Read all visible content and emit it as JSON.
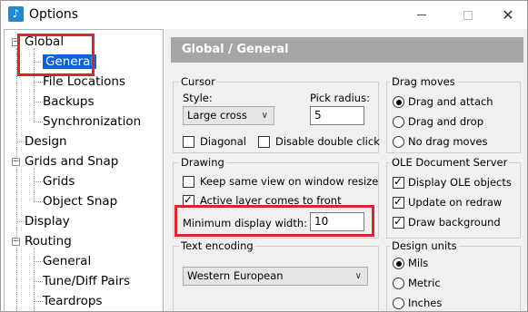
{
  "window": {
    "title": "Options",
    "app_icon": "music-note-icon"
  },
  "tree": {
    "items": [
      {
        "label": "Global",
        "level": 0,
        "expander": "−"
      },
      {
        "label": "General",
        "level": 1,
        "selected": true
      },
      {
        "label": "File Locations",
        "level": 1
      },
      {
        "label": "Backups",
        "level": 1
      },
      {
        "label": "Synchronization",
        "level": 1
      },
      {
        "label": "Design",
        "level": 0
      },
      {
        "label": "Grids and Snap",
        "level": 0,
        "expander": "−"
      },
      {
        "label": "Grids",
        "level": 1
      },
      {
        "label": "Object Snap",
        "level": 1
      },
      {
        "label": "Display",
        "level": 0
      },
      {
        "label": "Routing",
        "level": 0,
        "expander": "−"
      },
      {
        "label": "General",
        "level": 1
      },
      {
        "label": "Tune/Diff Pairs",
        "level": 1
      },
      {
        "label": "Teardrops",
        "level": 1
      }
    ]
  },
  "header": {
    "title": "Global / General"
  },
  "cursor": {
    "group_label": "Cursor",
    "style_label": "Style:",
    "style_value": "Large cross",
    "pick_radius_label": "Pick radius:",
    "pick_radius_value": "5",
    "diagonal_label": "Diagonal",
    "diagonal_checked": false,
    "disable_double_click_label": "Disable double click",
    "disable_double_click_checked": false
  },
  "drag_moves": {
    "group_label": "Drag moves",
    "options": [
      {
        "label": "Drag and attach",
        "selected": true
      },
      {
        "label": "Drag and drop",
        "selected": false
      },
      {
        "label": "No drag moves",
        "selected": false
      }
    ]
  },
  "drawing": {
    "group_label": "Drawing",
    "keep_same_view_label": "Keep same view on window resize",
    "keep_same_view_checked": false,
    "active_layer_front_label": "Active layer comes to front",
    "active_layer_front_checked": true,
    "min_display_width_label": "Minimum display width:",
    "min_display_width_value": "10"
  },
  "ole": {
    "group_label": "OLE Document Server",
    "display_ole_label": "Display OLE objects",
    "display_ole_checked": true,
    "update_on_redraw_label": "Update on redraw",
    "update_on_redraw_checked": true,
    "draw_background_label": "Draw background",
    "draw_background_checked": true
  },
  "text_encoding": {
    "group_label": "Text encoding",
    "value": "Western European"
  },
  "design_units": {
    "group_label": "Design units",
    "options": [
      {
        "label": "Mils",
        "selected": true
      },
      {
        "label": "Metric",
        "selected": false
      },
      {
        "label": "Inches",
        "selected": false
      }
    ]
  },
  "colors": {
    "highlight": "#d8262d",
    "selection": "#0a64d8",
    "header_bg": "#a6a6a6"
  }
}
